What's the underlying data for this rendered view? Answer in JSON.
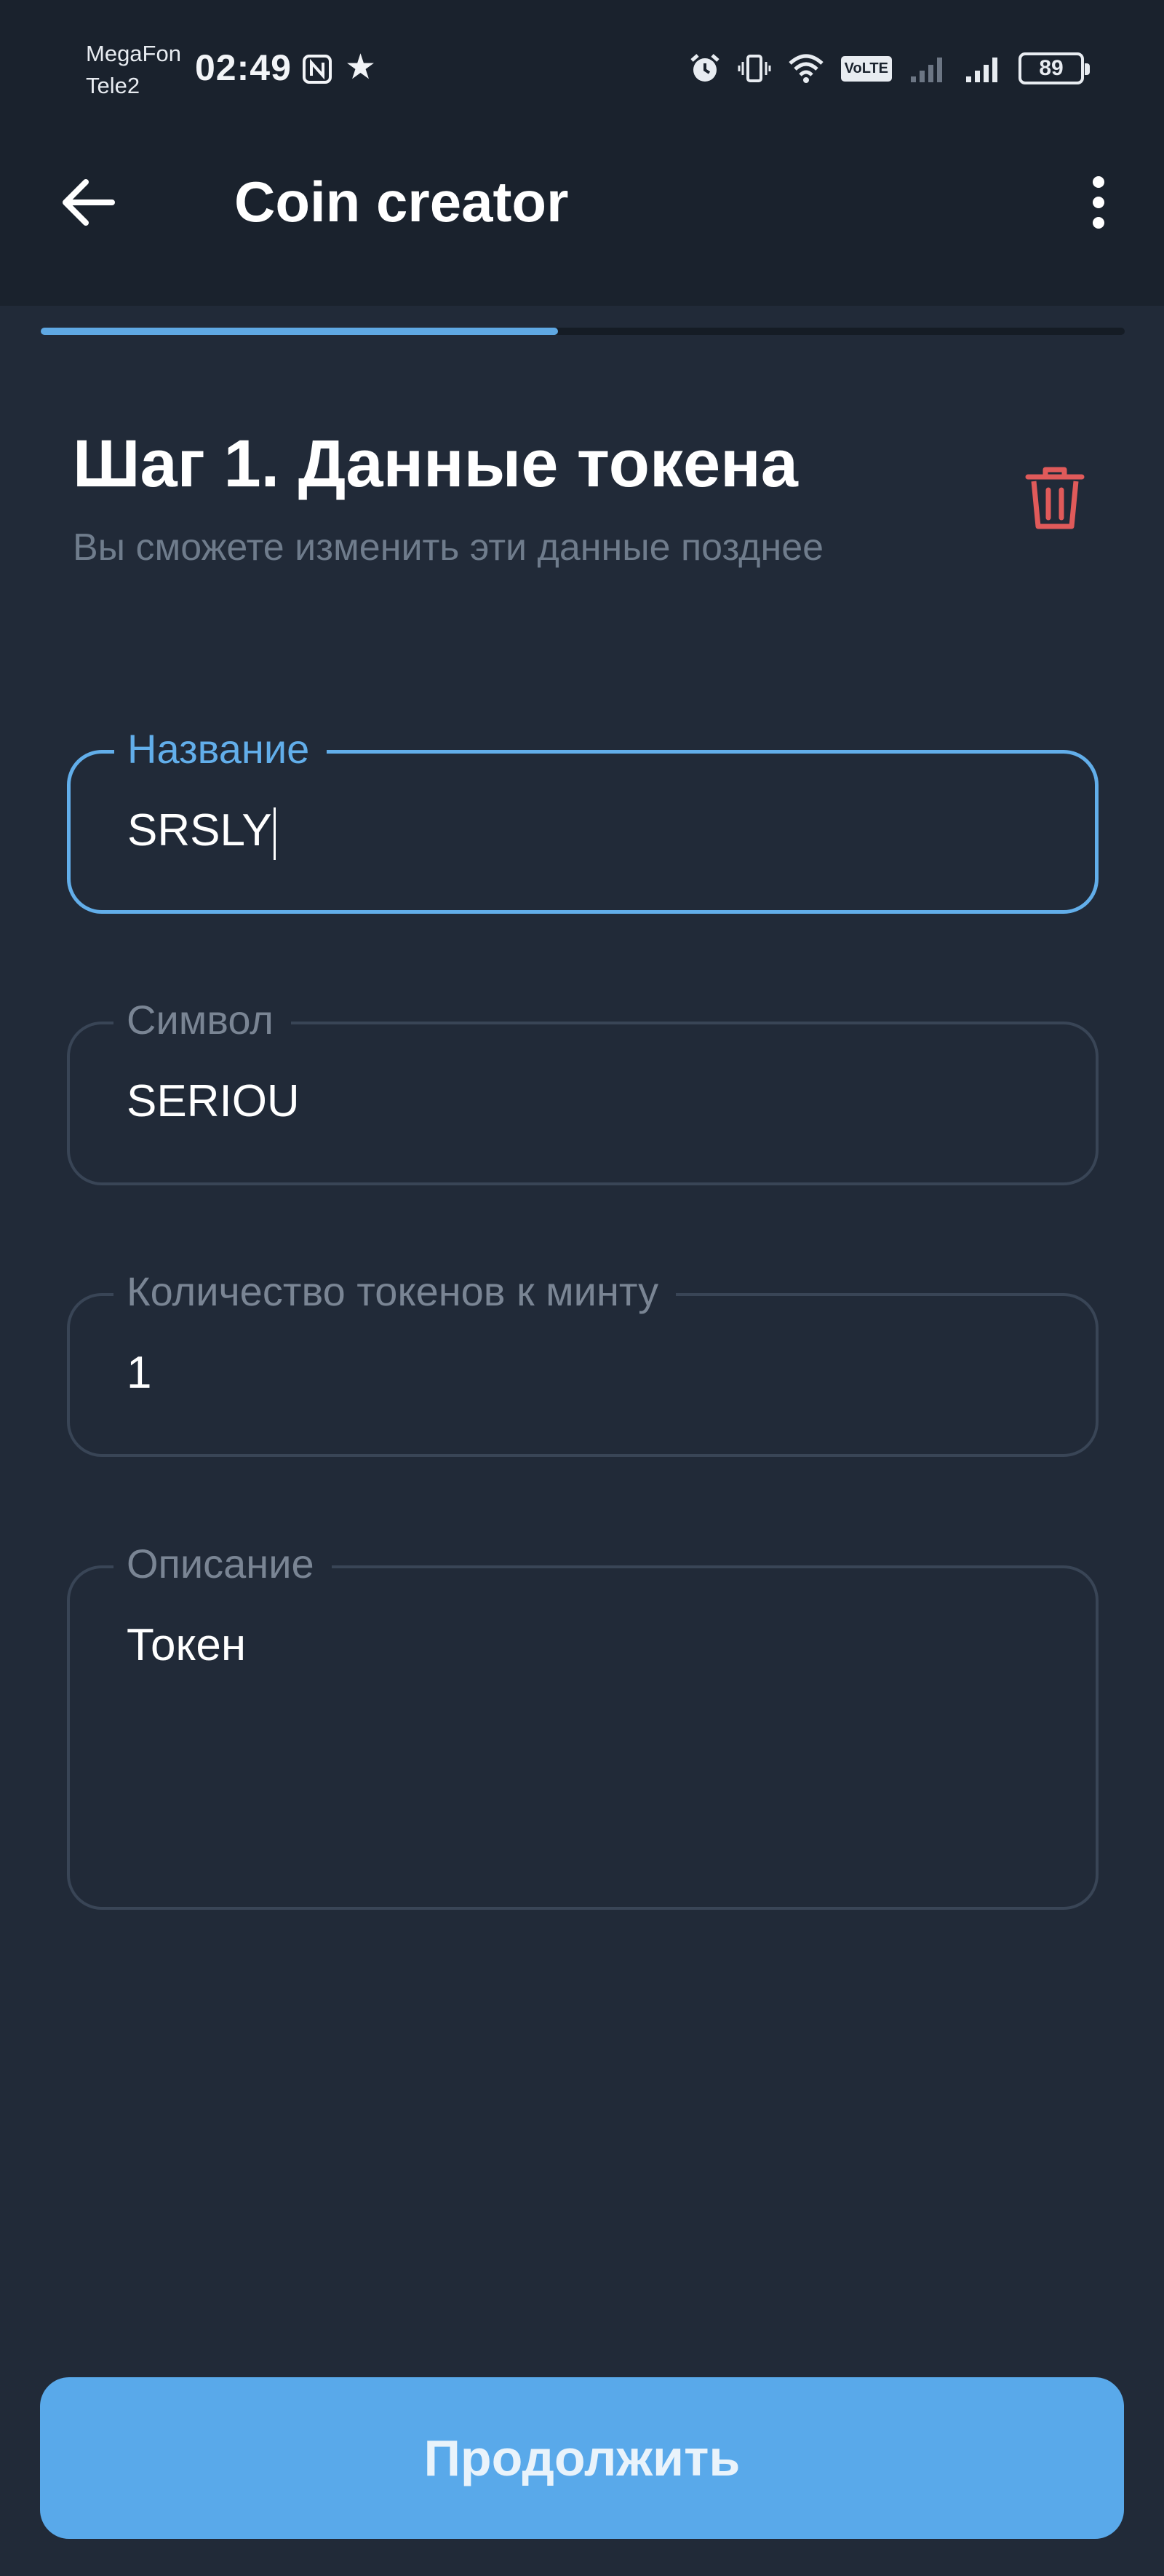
{
  "status_bar": {
    "carrier_1": "MegaFon",
    "carrier_2": "Tele2",
    "time": "02:49",
    "battery": "89",
    "icons": [
      "nfc-icon",
      "star-icon",
      "alarm-icon",
      "vibrate-icon",
      "wifi-icon",
      "volte-icon",
      "signal-icon",
      "signal-icon"
    ],
    "volte_label": "VoLTE"
  },
  "app_bar": {
    "title": "Coin creator",
    "back_icon": "arrow-left-icon",
    "menu_icon": "more-vertical-icon"
  },
  "progress": {
    "step": 1,
    "total_steps": 2,
    "fraction": 0.5,
    "accent": "#5fa8e3"
  },
  "step": {
    "title": "Шаг 1. Данные токена",
    "subtitle": "Вы сможете изменить эти данные позднее",
    "delete_icon": "trash-icon",
    "delete_color": "#e05a5a"
  },
  "form": {
    "name": {
      "label": "Название",
      "value": "SRSLY"
    },
    "symbol": {
      "label": "Символ",
      "value": "SERIOU"
    },
    "mint_amount": {
      "label": "Количество токенов к минту",
      "value": "1"
    },
    "description": {
      "label": "Описание",
      "value": "Токен"
    }
  },
  "continue_label": "Продолжить",
  "colors": {
    "background": "#212a38",
    "accent": "#59a9ea",
    "muted": "#6f7c8c"
  }
}
